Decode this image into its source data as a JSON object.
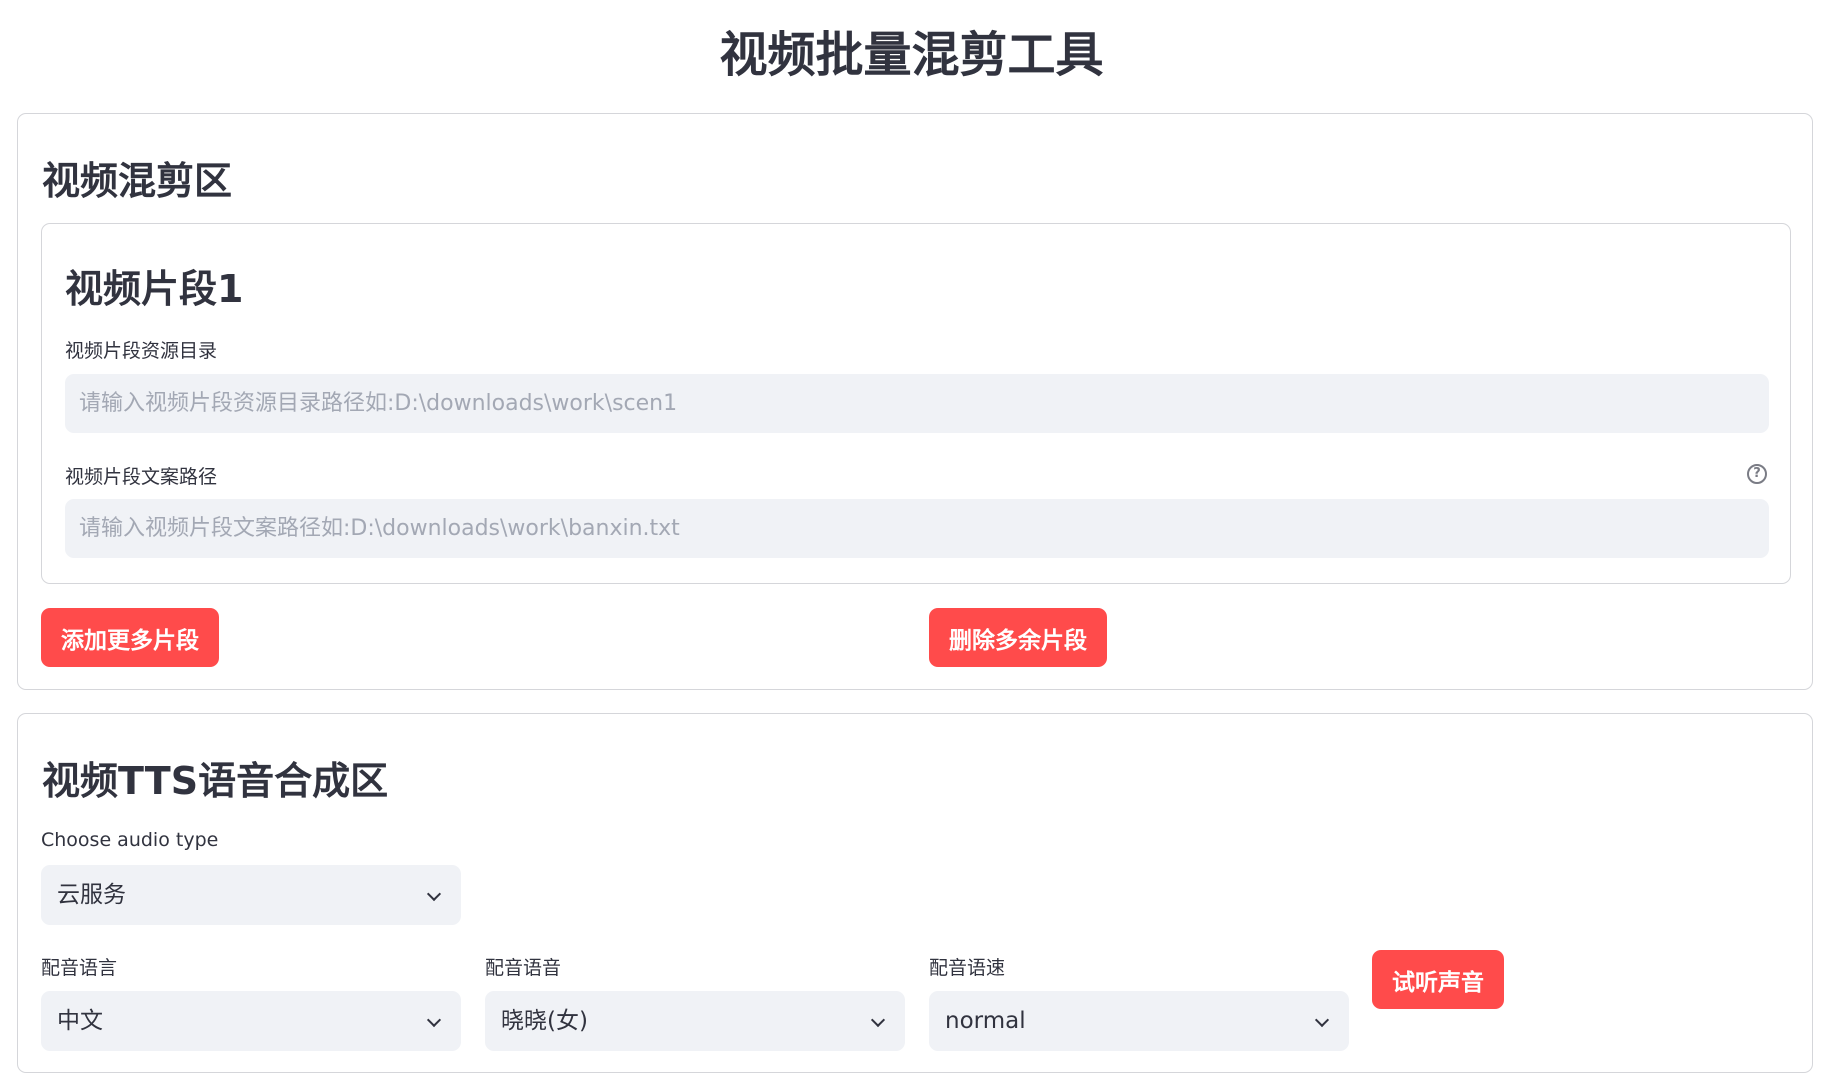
{
  "page": {
    "title": "视频批量混剪工具"
  },
  "mix_section": {
    "title": "视频混剪区",
    "segment": {
      "title": "视频片段1",
      "resource_dir_label": "视频片段资源目录",
      "resource_dir_value": "",
      "resource_dir_placeholder": "请输入视频片段资源目录路径如:D:\\downloads\\work\\scen1",
      "copy_path_label": "视频片段文案路径",
      "copy_path_value": "",
      "copy_path_placeholder": "请输入视频片段文案路径如:D:\\downloads\\work\\banxin.txt",
      "help_glyph": "?"
    },
    "add_button_label": "添加更多片段",
    "delete_button_label": "删除多余片段"
  },
  "tts_section": {
    "title": "视频TTS语音合成区",
    "audio_type_label": "Choose audio type",
    "audio_type_value": "云服务",
    "language_label": "配音语言",
    "language_value": "中文",
    "voice_label": "配音语音",
    "voice_value": "晓晓(女)",
    "speed_label": "配音语速",
    "speed_value": "normal",
    "listen_button_label": "试听声音"
  },
  "colors": {
    "accent": "#ff4b4b",
    "input_bg": "#f0f2f6",
    "text": "#31333f",
    "placeholder": "#a3a8b4",
    "border": "#d5d6da"
  },
  "icons": {
    "help": "question-circle-icon",
    "dropdown": "chevron-down-icon"
  }
}
